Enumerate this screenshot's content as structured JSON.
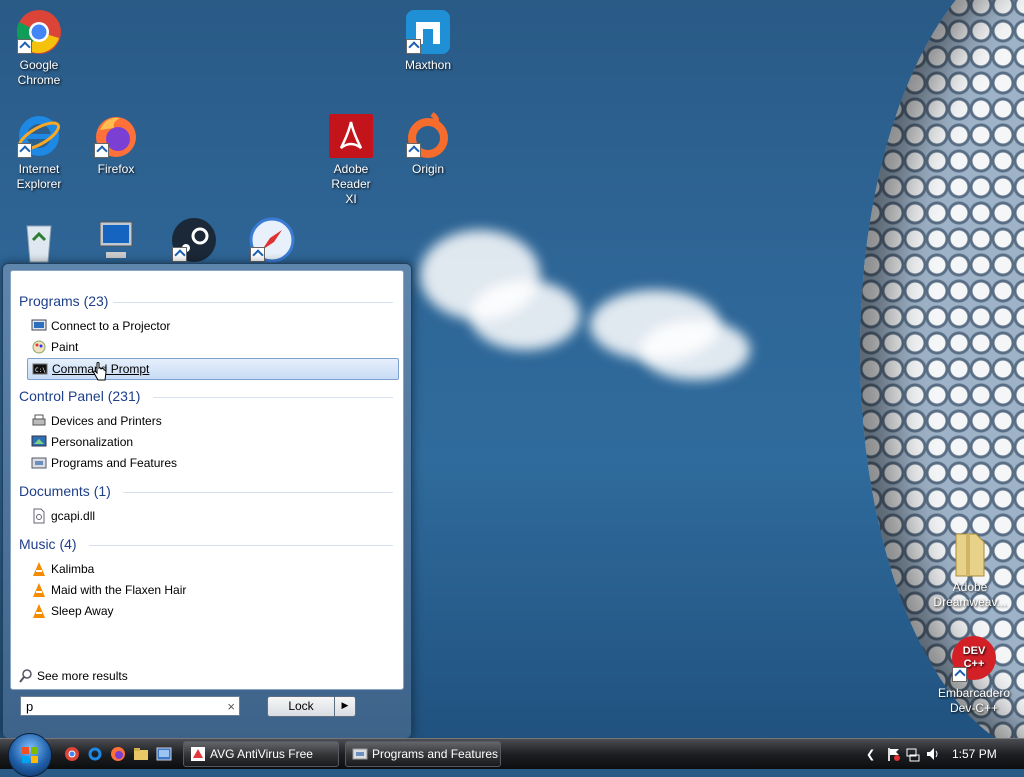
{
  "desktop": {
    "icons": [
      {
        "label_1": "Google",
        "label_2": "Chrome"
      },
      {
        "label_1": "Internet",
        "label_2": "Explorer"
      },
      {
        "label_1": "Firefox",
        "label_2": ""
      },
      {
        "label_1": "Maxthon",
        "label_2": ""
      },
      {
        "label_1": "Adobe Reader",
        "label_2": "XI"
      },
      {
        "label_1": "Origin",
        "label_2": ""
      },
      {
        "label_1": "Adobe",
        "label_2": "Dreamweav..."
      },
      {
        "label_1": "Embarcadero",
        "label_2": "Dev-C++"
      }
    ],
    "devcpp_badge": "DEV C++"
  },
  "start_menu": {
    "groups": [
      {
        "title": "Programs (23)",
        "items": [
          "Connect to a Projector",
          "Paint",
          "Command Prompt"
        ]
      },
      {
        "title": "Control Panel (231)",
        "items": [
          "Devices and Printers",
          "Personalization",
          "Programs and Features"
        ]
      },
      {
        "title": "Documents (1)",
        "items": [
          "gcapi.dll"
        ]
      },
      {
        "title": "Music (4)",
        "items": [
          "Kalimba",
          "Maid with the Flaxen Hair",
          "Sleep Away"
        ]
      }
    ],
    "see_more": "See more results",
    "search_value": "p",
    "search_clear": "×",
    "lock_label": "Lock",
    "lock_arrow": "▶"
  },
  "taskbar": {
    "buttons": [
      "AVG AntiVirus Free",
      "Programs and Features"
    ],
    "tray_chevron": "❮",
    "clock": "1:57 PM"
  },
  "colors": {
    "accent": "#1e3f8a",
    "selection": "#c8dcf5"
  }
}
